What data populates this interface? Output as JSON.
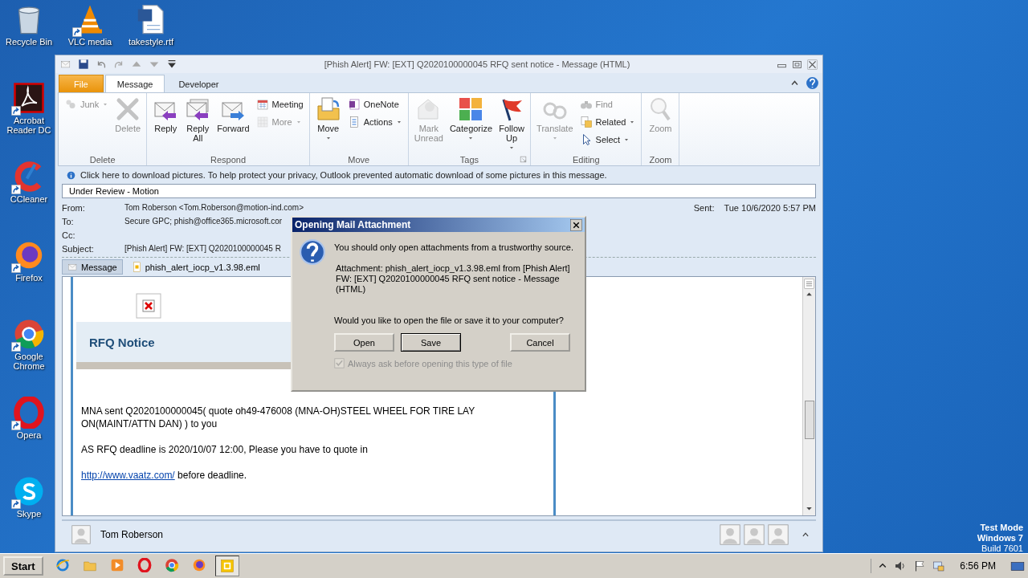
{
  "desktop_icons": [
    {
      "label": "Recycle Bin",
      "shortcut": false
    },
    {
      "label": "VLC media",
      "shortcut": true
    },
    {
      "label": "takestyle.rtf",
      "shortcut": false
    },
    {
      "label": "Acrobat Reader DC",
      "shortcut": true
    },
    {
      "label": "CCleaner",
      "shortcut": true
    },
    {
      "label": "Firefox",
      "shortcut": true
    },
    {
      "label": "Google Chrome",
      "shortcut": true
    },
    {
      "label": "Opera",
      "shortcut": true
    },
    {
      "label": "Skype",
      "shortcut": true
    }
  ],
  "window": {
    "title": "[Phish Alert] FW: [EXT] Q2020100000045 RFQ sent notice - Message (HTML)"
  },
  "tabs": [
    {
      "label": "File",
      "kind": "backstage",
      "selected": false
    },
    {
      "label": "Message",
      "kind": "tab",
      "selected": true
    },
    {
      "label": "Developer",
      "kind": "tab",
      "selected": false
    }
  ],
  "ribbon": [
    {
      "label": "Delete",
      "launcher": false,
      "items": [
        {
          "label": "Junk",
          "kind": "small",
          "disabled": true,
          "dropdown": true
        },
        {
          "label": "Delete",
          "kind": "large",
          "disabled": true,
          "dropdown": false
        }
      ]
    },
    {
      "label": "Respond",
      "launcher": false,
      "items": [
        {
          "label": "Reply",
          "kind": "large",
          "disabled": false,
          "dropdown": false
        },
        {
          "label": "Reply All",
          "kind": "large",
          "disabled": false,
          "dropdown": false
        },
        {
          "label": "Forward",
          "kind": "large",
          "disabled": false,
          "dropdown": false
        },
        {
          "label": "Meeting",
          "kind": "small",
          "disabled": false,
          "dropdown": false
        },
        {
          "label": "More",
          "kind": "small",
          "disabled": true,
          "dropdown": true
        }
      ]
    },
    {
      "label": "Move",
      "launcher": false,
      "items": [
        {
          "label": "Move",
          "kind": "large",
          "disabled": false,
          "dropdown": true
        },
        {
          "label": "OneNote",
          "kind": "small",
          "disabled": false,
          "dropdown": false
        },
        {
          "label": "Actions",
          "kind": "small",
          "disabled": false,
          "dropdown": true
        }
      ]
    },
    {
      "label": "Tags",
      "launcher": true,
      "items": [
        {
          "label": "Mark Unread",
          "kind": "large",
          "disabled": true,
          "dropdown": false
        },
        {
          "label": "Categorize",
          "kind": "large",
          "disabled": false,
          "dropdown": true
        },
        {
          "label": "Follow Up",
          "kind": "large",
          "disabled": false,
          "dropdown": true
        }
      ]
    },
    {
      "label": "Editing",
      "launcher": false,
      "items": [
        {
          "label": "Translate",
          "kind": "large",
          "disabled": true,
          "dropdown": true
        },
        {
          "label": "Find",
          "kind": "small",
          "disabled": true,
          "dropdown": false
        },
        {
          "label": "Related",
          "kind": "small",
          "disabled": false,
          "dropdown": true
        },
        {
          "label": "Select",
          "kind": "small",
          "disabled": false,
          "dropdown": true
        }
      ]
    },
    {
      "label": "Zoom",
      "launcher": false,
      "items": [
        {
          "label": "Zoom",
          "kind": "large",
          "disabled": true,
          "dropdown": false
        }
      ]
    }
  ],
  "info_bar": {
    "text": "Click here to download pictures. To help protect your privacy, Outlook prevented automatic download of some pictures in this message."
  },
  "category": "Under Review - Motion",
  "header": {
    "fields": [
      {
        "label": "From:",
        "value": "Tom Roberson <Tom.Roberson@motion-ind.com>"
      },
      {
        "label": "To:",
        "value": "Secure GPC; phish@office365.microsoft.cor"
      },
      {
        "label": "Cc:"
      },
      {
        "label": "Subject:",
        "value": "[Phish Alert] FW: [EXT] Q2020100000045 R"
      }
    ],
    "sent_label": "Sent:",
    "sent_value": "Tue 10/6/2020 5:57 PM"
  },
  "attachments": [
    {
      "label": "Message",
      "selected": true
    },
    {
      "label": "phish_alert_iocp_v1.3.98.eml",
      "selected": false
    }
  ],
  "body": {
    "heading": "RFQ Notice",
    "paragraphs": [
      "MNA sent Q2020100000045( quote oh49-476008 (MNA-OH)STEEL WHEEL FOR TIRE LAY ON(MAINT/ATTN DAN) ) to you",
      "AS RFQ deadline is 2020/10/07 12:00, Please you have to quote in"
    ],
    "link": "http://www.vaatz.com/",
    "link_suffix": " before deadline."
  },
  "people_pane": {
    "name": "Tom Roberson"
  },
  "dialog": {
    "title": "Opening Mail Attachment",
    "warning": "You should only open attachments from a trustworthy source.",
    "attachment_text": "Attachment: phish_alert_iocp_v1.3.98.eml from [Phish Alert] FW: [EXT] Q2020100000045 RFQ sent notice - Message (HTML)",
    "question": "Would you like to open the file or save it to your computer?",
    "buttons": [
      {
        "label": "Open",
        "default": false
      },
      {
        "label": "Save",
        "default": true
      },
      {
        "label": "Cancel",
        "default": false
      }
    ],
    "checkbox": {
      "label": "Always ask before opening this type of file",
      "checked": true,
      "disabled": true
    }
  },
  "system_notice": [
    "Test Mode",
    "Windows 7",
    "Build 7601"
  ],
  "taskbar": {
    "start": "Start",
    "time": "6:56 PM",
    "apps": [
      {
        "selected": false
      },
      {
        "selected": false
      },
      {
        "selected": false
      },
      {
        "selected": false
      },
      {
        "selected": false
      },
      {
        "selected": false
      },
      {
        "selected": true
      }
    ]
  }
}
